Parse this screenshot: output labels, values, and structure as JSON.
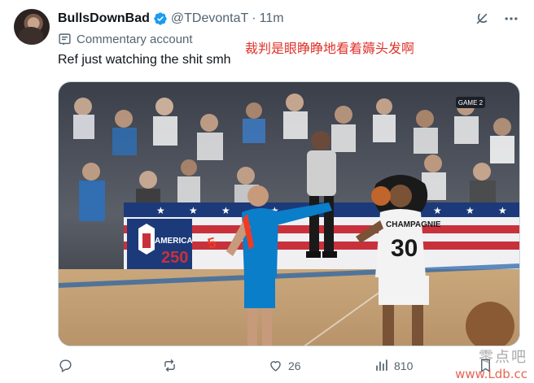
{
  "tweet": {
    "display_name": "BullsDownBad",
    "handle": "@TDevontaT",
    "separator": "·",
    "time": "11m",
    "label": "Commentary account",
    "text": "Ref just watching the shit smh",
    "overlay_caption": "裁判是眼睁睁地看着薅头发啊"
  },
  "media": {
    "jersey_30_text": "CHAMPAGNIE",
    "jersey_30_number": "30",
    "jersey_5_number": "5",
    "banner_text": "AMERICA",
    "banner_number": "250",
    "scorebug": "GAME 2"
  },
  "actions": {
    "reply_count": "",
    "repost_count": "",
    "like_count": "26",
    "views_count": "810"
  },
  "watermark": {
    "line1": "零点吧",
    "line2": "www.Ldb.cc"
  },
  "colors": {
    "verified_blue": "#1d9bf0",
    "muted_text": "#536471",
    "caption_red": "#e0322a",
    "thunder_blue": "#007ac1",
    "thunder_orange": "#ef3b24"
  },
  "icons": [
    "verified-badge-icon",
    "grok-icon",
    "more-icon",
    "commentary-icon",
    "reply-icon",
    "repost-icon",
    "like-icon",
    "views-icon",
    "bookmark-icon"
  ]
}
